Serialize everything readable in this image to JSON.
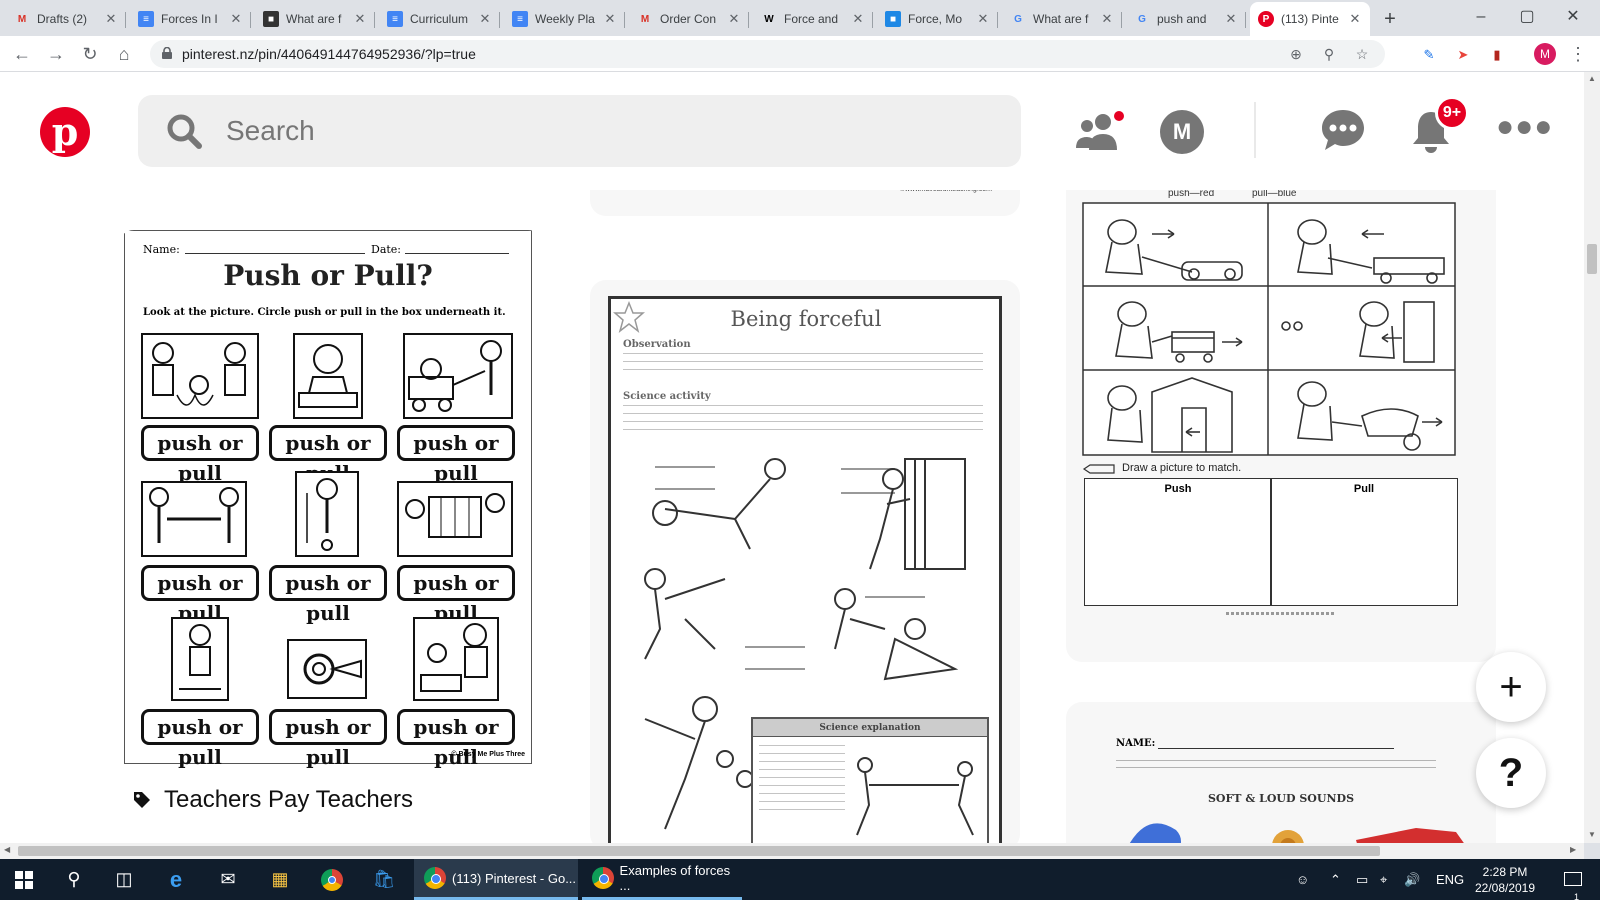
{
  "browser": {
    "tabs": [
      {
        "title": "Drafts (2)",
        "icon": "gmail-icon",
        "color": "#d93025"
      },
      {
        "title": "Forces In I",
        "icon": "docs-icon",
        "color": "#4285f4"
      },
      {
        "title": "What are f",
        "icon": "site-icon",
        "color": "#333333"
      },
      {
        "title": "Curriculum",
        "icon": "docs-icon",
        "color": "#4285f4"
      },
      {
        "title": "Weekly Pla",
        "icon": "docs-icon",
        "color": "#4285f4"
      },
      {
        "title": "Order Con",
        "icon": "gmail-icon",
        "color": "#d93025"
      },
      {
        "title": "Force and",
        "icon": "wikipedia-icon",
        "color": "#000000"
      },
      {
        "title": "Force, Mo",
        "icon": "site-icon",
        "color": "#1e88e5"
      },
      {
        "title": "What are f",
        "icon": "google-icon",
        "color": "#4285f4"
      },
      {
        "title": "push and",
        "icon": "google-icon",
        "color": "#4285f4"
      },
      {
        "title": "(113) Pinte",
        "icon": "pinterest-icon",
        "color": "#e60023",
        "active": true
      }
    ],
    "url": "pinterest.nz/pin/440649144764952936/?lp=true",
    "profile_initial": "M"
  },
  "pinterest": {
    "search_placeholder": "Search",
    "avatar_initial": "M",
    "notification_badge": "9+",
    "brand_color": "#e60023"
  },
  "pins": {
    "left": {
      "name_label": "Name:",
      "date_label": "Date:",
      "title": "Push or Pull?",
      "instruction": "Look at the picture. Circle push or pull in the box underneath it.",
      "answer_label": "push or pull",
      "credit": "© Busy Me Plus Three",
      "source_label": "Teachers Pay Teachers"
    },
    "middle": {
      "title": "Being forceful",
      "section1": "Observation",
      "section2": "Science activity",
      "box_title": "Science explanation",
      "top_credit": "©www.haveafunteaching.com"
    },
    "right": {
      "legend_push": "push—red",
      "legend_pull": "pull—blue",
      "draw_instruction": "Draw a picture to match.",
      "col_push": "Push",
      "col_pull": "Pull"
    },
    "right2": {
      "name_label": "NAME:",
      "title": "SOFT & LOUD SOUNDS"
    }
  },
  "fabs": {
    "add": "+",
    "help": "?"
  },
  "taskbar": {
    "apps": [
      {
        "label": "(113) Pinterest - Go...",
        "active": true
      },
      {
        "label": "Examples of forces ...",
        "active": false
      }
    ],
    "language": "ENG",
    "time": "2:28 PM",
    "date": "22/08/2019",
    "notification_count": "1"
  }
}
